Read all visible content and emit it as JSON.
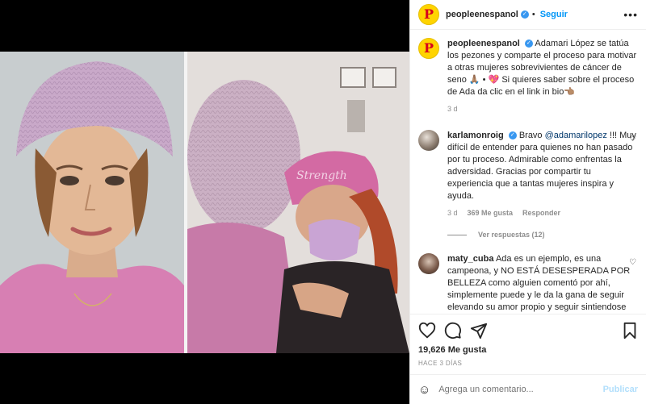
{
  "post": {
    "username": "peopleenespanol",
    "follow_label": "Seguir",
    "avatar_letter": "P",
    "caption": "Adamari López se tatúa los pezones y comparte el proceso para motivar a otras mujeres sobrevivientes de cáncer de seno 🙏🏽 • 💖 Si quieres saber sobre el proceso de Ada da clic en el link in bio👈🏽",
    "caption_age": "3 d"
  },
  "comments": [
    {
      "username": "karlamonroig",
      "mention": "@adamarilopez",
      "text_before": "Bravo ",
      "text_after": " !!! Muy difícil de entender para quienes no han pasado por tu proceso. Admirable como enfrentas la adversidad. Gracias por compartir tu experiencia que a tantas mujeres inspira y ayuda.",
      "age": "3 d",
      "likes": "369 Me gusta",
      "reply_label": "Responder",
      "view_replies": "Ver respuestas (12)"
    },
    {
      "username": "maty_cuba",
      "text": "Ada es un ejemplo, es una campeona, y NO ESTÁ DESESPERADA POR BELLEZA como alguien comentó por ahí, simplemente puede y le da la gana de seguir elevando su amor propio y seguir sintiendose bien con ella misma, ejemplo a imitar, por qué"
    }
  ],
  "actions": {
    "likes": "19,626 Me gusta",
    "time": "HACE 3 DÍAS"
  },
  "add_comment": {
    "placeholder": "Agrega un comentario...",
    "publish_label": "Publicar"
  },
  "icons": {
    "header_more": "more-horizontal-icon",
    "like": "heart-icon",
    "comment": "comment-icon",
    "share": "send-icon",
    "save": "bookmark-icon",
    "emoji": "emoji-icon"
  },
  "colors": {
    "link_blue": "#0095f6",
    "verified_blue": "#3897f0",
    "muted": "#8e8e8e",
    "publish_disabled": "#b2dffc"
  }
}
